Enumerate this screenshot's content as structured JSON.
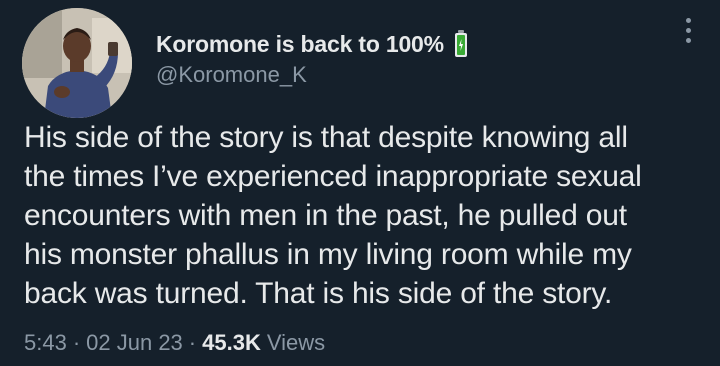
{
  "author": {
    "display_name": "Koromone is back to 100%",
    "handle": "@Koromone_K",
    "emoji_icon": "battery-full-icon"
  },
  "tweet": {
    "lines": [
      "His side of the story is that despite knowing all",
      "the times I’ve experienced inappropriate sexual",
      "encounters with men in the past, he pulled out",
      "his monster phallus in my living room while my",
      "back was turned. That is his side of the story."
    ]
  },
  "meta": {
    "time": "5:43",
    "separator1": "·",
    "date": "02 Jun 23",
    "separator2": "·",
    "views_count": "45.3K",
    "views_label": "Views"
  },
  "colors": {
    "background": "#15202b",
    "text_primary": "#e7e9ea",
    "text_secondary": "#8b98a5",
    "battery_green": "#3aaa35"
  }
}
